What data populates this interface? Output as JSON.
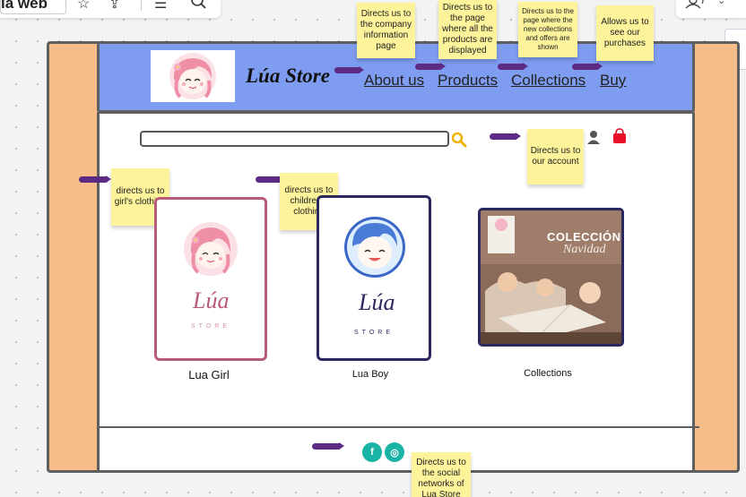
{
  "board": {
    "title": "ia web"
  },
  "site": {
    "brand_name": "Lúa Store",
    "nav": [
      "About us",
      "Products",
      "Collections",
      "Buy"
    ]
  },
  "notes": {
    "about": "Directs us to the company information page",
    "products": "Directs us to the page where all the products are displayed",
    "collections": "Directs us to the page where the new collections and offers are shown",
    "buy": "Allows us to see our purchases",
    "account": "Directs us to our account",
    "girls": "directs us to girl's clothing",
    "children": "directs us to children's clothing",
    "social": "Directs us to the social networks of Lua Store"
  },
  "cards": {
    "girl": {
      "label": "Lua Girl",
      "logo_text": "Lúa",
      "logo_sub": "STORE"
    },
    "boy": {
      "label": "Lua Boy",
      "logo_text": "Lúa",
      "logo_sub": "STORE"
    },
    "collections": {
      "label": "Collections",
      "title": "COLECCIÓN",
      "subtitle": "Navidad"
    }
  },
  "social": {
    "facebook": "f",
    "instagram": "◎"
  },
  "colors": {
    "frame": "#f7bd89",
    "header": "#7e9cf0",
    "sticky": "#fdf39b",
    "arrow": "#5d2a84",
    "girl_border": "#b85b7a",
    "boy_border": "#2b2860",
    "cart": "#e8102a",
    "social": "#1bb3a5"
  }
}
